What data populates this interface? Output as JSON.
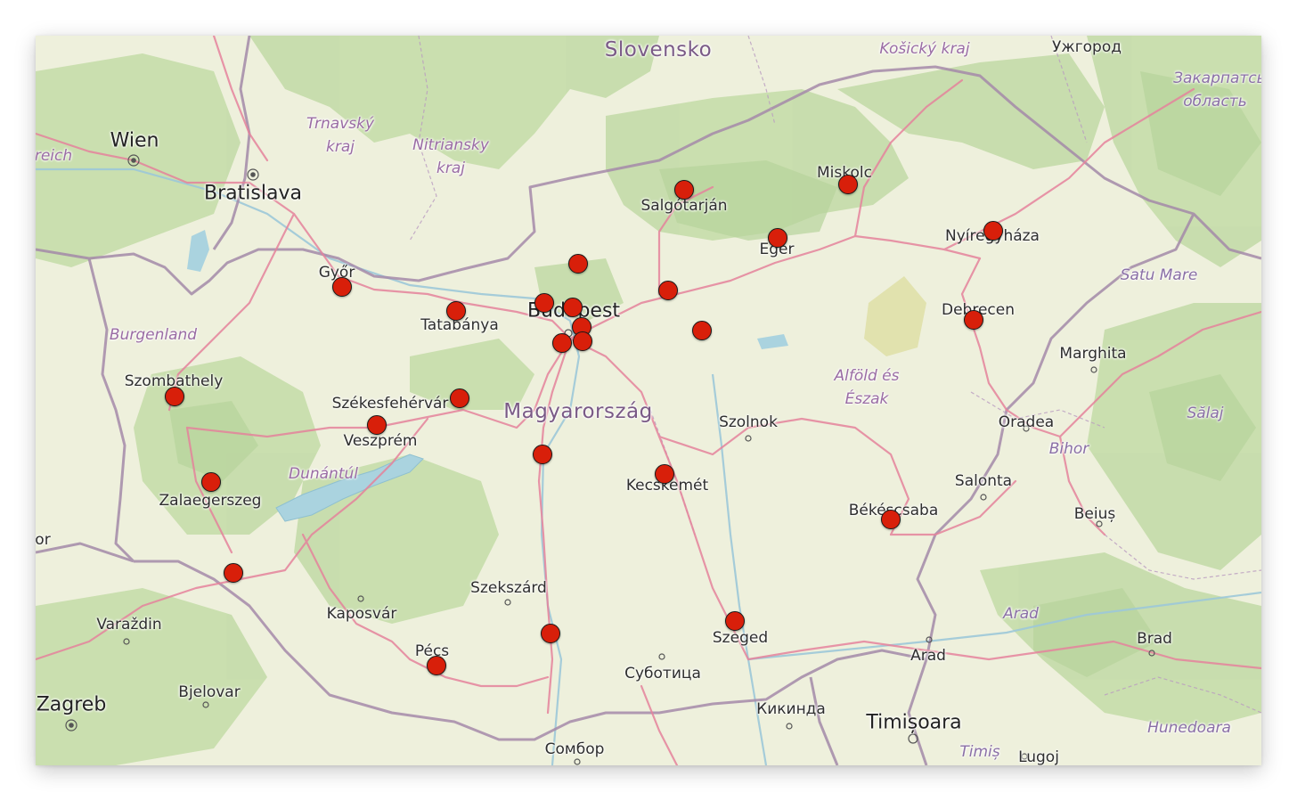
{
  "map": {
    "labels": {
      "slovensko": "Slovensko",
      "kosicky": "Košický kraj",
      "uzhhorod": "Ужгород",
      "zakarpatska_1": "Закарпатськ",
      "zakarpatska_2": "область",
      "wien": "Wien",
      "reich": "reich",
      "bratislava": "Bratislava",
      "trnavsky_1": "Trnavský",
      "trnavsky_2": "kraj",
      "nitriansky_1": "Nitriansky",
      "nitriansky_2": "kraj",
      "salgotarjan": "Salgótarján",
      "miskolc": "Miskolc",
      "eger": "Eger",
      "nyiregyhaza": "Nyíregyháza",
      "gyor": "Győr",
      "tatabanya": "Tatabánya",
      "budapest": "Budapest",
      "debrecen": "Debrecen",
      "satu_mare": "Satu Mare",
      "burgenland": "Burgenland",
      "marghita": "Marghita",
      "alfold_1": "Alföld és",
      "alfold_2": "Észak",
      "szombathely": "Szombathely",
      "szekesfehervar": "Székesfehérvár",
      "veszprem": "Veszprém",
      "magyarorszag": "Magyarország",
      "szolnok": "Szolnok",
      "oradea": "Oradea",
      "salaj": "Sălaj",
      "bihor": "Bihor",
      "dunantul": "Dunántúl",
      "zalaegerszeg": "Zalaegerszeg",
      "kecskemet": "Kecskemét",
      "salonta": "Salonta",
      "bekescsaba": "Békéscsaba",
      "beius": "Beiuș",
      "or": "or",
      "szekszard": "Szekszárd",
      "kaposvar": "Kaposvár",
      "varazdin": "Varaždin",
      "arad_region": "Arad",
      "brad": "Brad",
      "pecs": "Pécs",
      "szeged": "Szeged",
      "arad": "Arad",
      "subotica": "Суботица",
      "bjelovar": "Bjelovar",
      "zagreb": "Zagreb",
      "kikinda": "Кикинда",
      "timisoara": "Timișoara",
      "hunedoara": "Hunedoara",
      "sombor": "Сомбор",
      "timis": "Timiș",
      "lugoj": "Lugoj"
    },
    "colors": {
      "marker_fill": "#d81f0a",
      "marker_stroke": "#1a1a1a",
      "road": "#e5839c",
      "border": "#a48aa9",
      "water": "#aad3df",
      "forest": "#c3dca6",
      "land": "#eef0dc"
    },
    "marker_count": 26
  }
}
